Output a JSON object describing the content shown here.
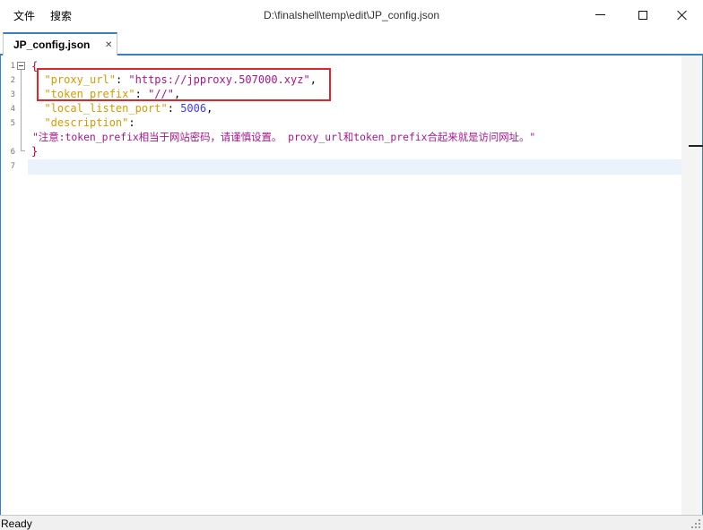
{
  "menu": {
    "file": "文件",
    "search": "搜索"
  },
  "window": {
    "title": "D:\\finalshell\\temp\\edit\\JP_config.json"
  },
  "tab": {
    "label": "JP_config.json",
    "close": "✕"
  },
  "editor": {
    "line_numbers": [
      "1",
      "2",
      "3",
      "4",
      "5",
      "6",
      "7"
    ],
    "tokens": {
      "open_brace": "{",
      "proxy_key": "\"proxy_url\"",
      "colon": ": ",
      "proxy_value": "\"https://jpproxy.507000.xyz\"",
      "comma": ",",
      "token_key": "\"token_prefix\"",
      "token_value": "\"//\"",
      "port_key": "\"local_listen_port\"",
      "port_value": "5006",
      "desc_key": "\"description\"",
      "desc_colon": ":",
      "desc_value": "\"注意:token_prefix相当于网站密码，请谨慎设置。 proxy_url和token_prefix合起来就是访问网址。\"",
      "close_brace": "}"
    }
  },
  "status": {
    "text": "Ready"
  },
  "colors": {
    "accent": "#3c7fc0",
    "highlight_box": "#e0262b",
    "key": "#d69a00",
    "string": "#a6158f",
    "number": "#3a3aff"
  }
}
